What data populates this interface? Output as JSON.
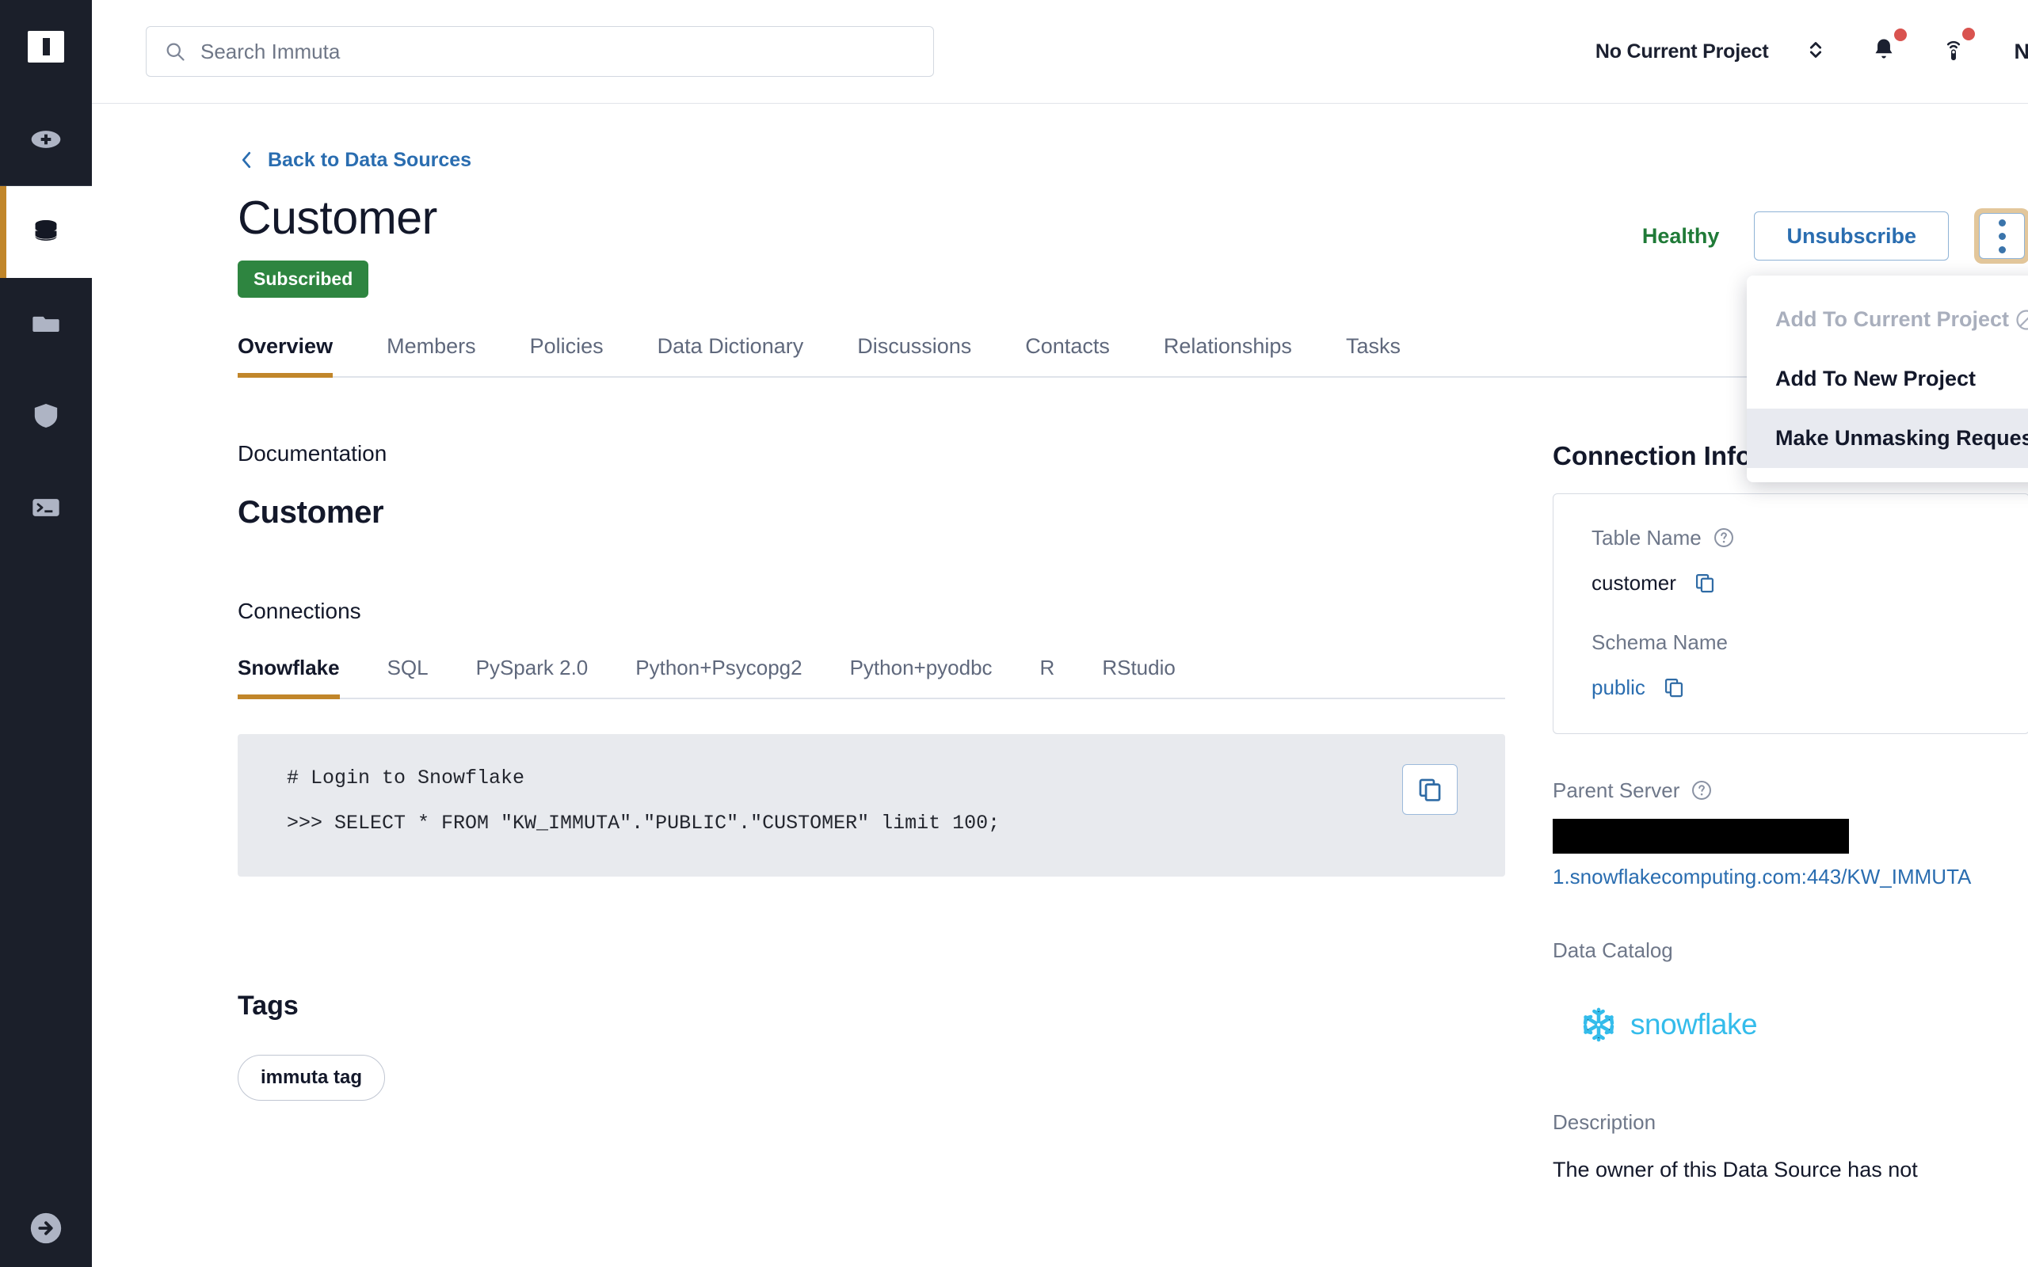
{
  "sidebar": {
    "logo_name": "immuta-logo",
    "items": [
      {
        "label": "Add",
        "icon": "plus-circle-icon",
        "active": false
      },
      {
        "label": "Data Sources",
        "icon": "database-icon",
        "active": true
      },
      {
        "label": "Projects",
        "icon": "folder-icon",
        "active": false
      },
      {
        "label": "Governance",
        "icon": "shield-icon",
        "active": false
      },
      {
        "label": "Query Engine",
        "icon": "terminal-icon",
        "active": false
      }
    ],
    "expand_label": "Expand sidebar",
    "expand_icon": "arrow-right-circle-icon"
  },
  "header": {
    "search_placeholder": "Search Immuta",
    "search_value": "",
    "search_icon": "search-icon",
    "project_label": "No Current Project",
    "project_selector_icon": "chevron-up-down-icon",
    "notifications_icon": "bell-icon",
    "notifications_badge": true,
    "broadcast_icon": "broadcast-icon",
    "broadcast_badge": true,
    "avatar_initial": "N"
  },
  "page": {
    "back_link": "Back to Data Sources",
    "back_icon": "chevron-left-icon",
    "title": "Customer",
    "subscription_badge": "Subscribed",
    "health_status": "Healthy",
    "unsubscribe_label": "Unsubscribe",
    "kebab_icon": "kebab-menu-icon"
  },
  "tabs": [
    {
      "label": "Overview",
      "active": true
    },
    {
      "label": "Members",
      "active": false
    },
    {
      "label": "Policies",
      "active": false
    },
    {
      "label": "Data Dictionary",
      "active": false
    },
    {
      "label": "Discussions",
      "active": false
    },
    {
      "label": "Contacts",
      "active": false
    },
    {
      "label": "Relationships",
      "active": false
    },
    {
      "label": "Tasks",
      "active": false
    }
  ],
  "dropdown": {
    "items": [
      {
        "label": "Add To Current Project",
        "disabled": true,
        "hovered": false,
        "icon": "no-entry-icon"
      },
      {
        "label": "Add To New Project",
        "disabled": false,
        "hovered": false,
        "icon": ""
      },
      {
        "label": "Make Unmasking Request",
        "disabled": false,
        "hovered": true,
        "icon": ""
      }
    ]
  },
  "documentation": {
    "section_label": "Documentation",
    "heading": "Customer"
  },
  "connections": {
    "section_label": "Connections",
    "tabs": [
      {
        "label": "Snowflake",
        "active": true
      },
      {
        "label": "SQL",
        "active": false
      },
      {
        "label": "PySpark 2.0",
        "active": false
      },
      {
        "label": "Python+Psycopg2",
        "active": false
      },
      {
        "label": "Python+pyodbc",
        "active": false
      },
      {
        "label": "R",
        "active": false
      },
      {
        "label": "RStudio",
        "active": false
      }
    ],
    "code_line_1": "# Login to Snowflake",
    "code_line_2": ">>> SELECT * FROM \"KW_IMMUTA\".\"PUBLIC\".\"CUSTOMER\" limit 100;",
    "copy_icon": "copy-icon"
  },
  "tags": {
    "section_label": "Tags",
    "items": [
      "immuta tag"
    ]
  },
  "connection_info": {
    "heading": "Connection Information",
    "table_name_label": "Table Name",
    "table_name_value": "customer",
    "schema_name_label": "Schema Name",
    "schema_name_value": "public",
    "parent_server_label": "Parent Server",
    "parent_server_redacted": true,
    "parent_server_link": "1.snowflakecomputing.com:443/KW_IMMUTA",
    "data_catalog_label": "Data Catalog",
    "data_catalog_value": "snowflake",
    "description_label": "Description",
    "description_value": "The owner of this Data Source has not",
    "help_icon": "help-circle-icon",
    "copy_icon": "copy-icon"
  },
  "colors": {
    "accent_orange": "#c1862a",
    "link_blue": "#2a6db0",
    "success_green": "#2e8540",
    "health_green": "#1f7a37",
    "sidebar_bg": "#1b1f2a",
    "badge_red": "#d9534f",
    "snowflake_blue": "#34bceb",
    "focus_ring": "#e3c79b"
  }
}
